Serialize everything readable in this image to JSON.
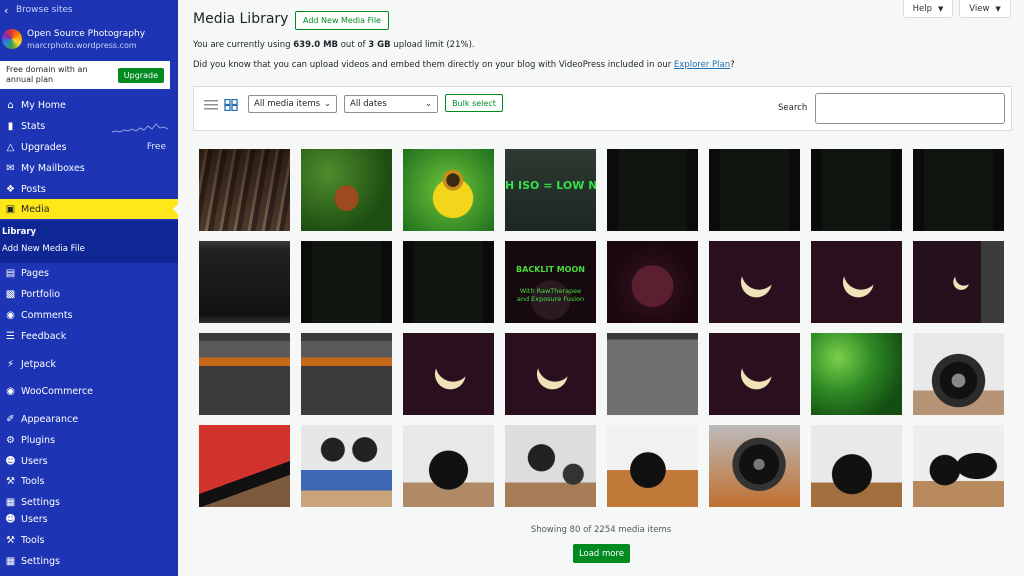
{
  "sidebar": {
    "back_label": "Browse sites",
    "site_title": "Open Source Photography",
    "site_url": "marcrphoto.wordpress.com",
    "promo_text": "Free domain with an annual plan",
    "promo_button": "Upgrade",
    "items": [
      {
        "label": "My Home",
        "icon": "home-icon"
      },
      {
        "label": "Stats",
        "icon": "stats-icon"
      },
      {
        "label": "Upgrades",
        "icon": "upgrades-icon",
        "right": "Free"
      },
      {
        "label": "My Mailboxes",
        "icon": "mail-icon"
      },
      {
        "label": "Posts",
        "icon": "pin-icon"
      },
      {
        "label": "Media",
        "icon": "media-icon",
        "active": true
      },
      {
        "label": "Pages",
        "icon": "page-icon"
      },
      {
        "label": "Portfolio",
        "icon": "portfolio-icon"
      },
      {
        "label": "Comments",
        "icon": "comment-icon"
      },
      {
        "label": "Feedback",
        "icon": "feedback-icon"
      },
      {
        "label": "Jetpack",
        "icon": "jetpack-icon"
      },
      {
        "label": "WooCommerce",
        "icon": "woo-icon"
      },
      {
        "label": "Appearance",
        "icon": "brush-icon"
      },
      {
        "label": "Plugins",
        "icon": "plugin-icon"
      },
      {
        "label": "Users",
        "icon": "users-icon"
      },
      {
        "label": "Tools",
        "icon": "tools-icon"
      },
      {
        "label": "Settings",
        "icon": "settings-icon"
      },
      {
        "label": "Users",
        "icon": "users-icon"
      },
      {
        "label": "Tools",
        "icon": "tools-icon"
      },
      {
        "label": "Settings",
        "icon": "settings-icon"
      }
    ],
    "submenu": [
      "Library",
      "Add New Media File"
    ]
  },
  "header": {
    "title": "Media Library",
    "add_new": "Add New Media File",
    "help": "Help",
    "view": "View"
  },
  "usage": {
    "prefix": "You are currently using ",
    "used": "639.0 MB",
    "middle": " out of ",
    "limit": "3 GB",
    "suffix": " upload limit (21%)."
  },
  "notice": {
    "text": "Did you know that you can upload videos and embed them directly on your blog with VideoPress included in our ",
    "link": "Explorer Plan",
    "end": "?"
  },
  "toolbar": {
    "filter_type": "All media items",
    "filter_date": "All dates",
    "bulk_select": "Bulk select",
    "search_label": "Search",
    "search_value": ""
  },
  "media": {
    "captions": {
      "iso": "H ISO = LOW NO",
      "moon_title": "BACKLIT MOON",
      "moon_sub1": "With RawTherapee",
      "moon_sub2": "and Exposure Fusion"
    },
    "tiles": [
      "wood-dock",
      "red-deer",
      "bee-flower",
      "iso-slide",
      "dark-screenshot",
      "dark-screenshot",
      "dark-screenshot",
      "dark-screenshot",
      "dark-square",
      "dark-screenshot",
      "dark-screenshot",
      "backlit-moon",
      "red-moon",
      "crescent-moon",
      "crescent-moon",
      "small-crescent",
      "software-screenshot",
      "software-screenshot",
      "crescent-moon",
      "crescent-moon",
      "grey-screenshot",
      "crescent-moon",
      "green-leaves",
      "camera",
      "cf-adapter",
      "lens-rings",
      "camera-top",
      "camera-rings",
      "camera-table",
      "lens-macro",
      "camera-lens",
      "camera-tele"
    ],
    "showing_text": "Showing 80 of 2254 media items",
    "load_more": "Load more"
  }
}
